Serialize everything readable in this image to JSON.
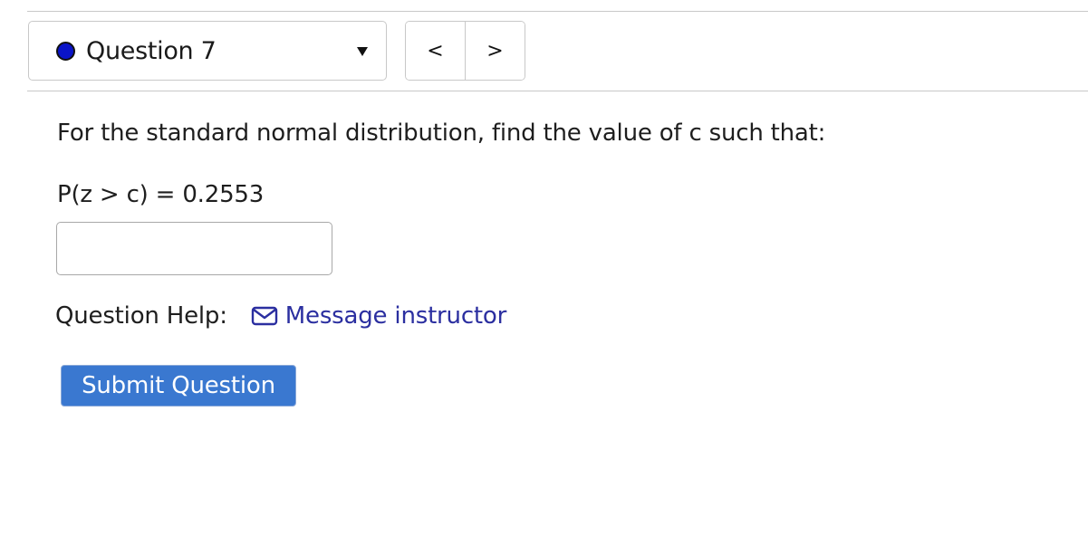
{
  "question_nav": {
    "selected_label": "Question 7",
    "status_dot_color": "#0a14c8",
    "prev_symbol": "<",
    "next_symbol": ">"
  },
  "question": {
    "prompt": "For the standard normal distribution, find the value of c such that:",
    "expression": "P(z > c) = 0.2553",
    "answer_value": ""
  },
  "help": {
    "label": "Question Help:",
    "icon": "envelope-icon",
    "link_text": "Message instructor"
  },
  "actions": {
    "submit_label": "Submit Question",
    "submit_color": "#3a78d0"
  }
}
